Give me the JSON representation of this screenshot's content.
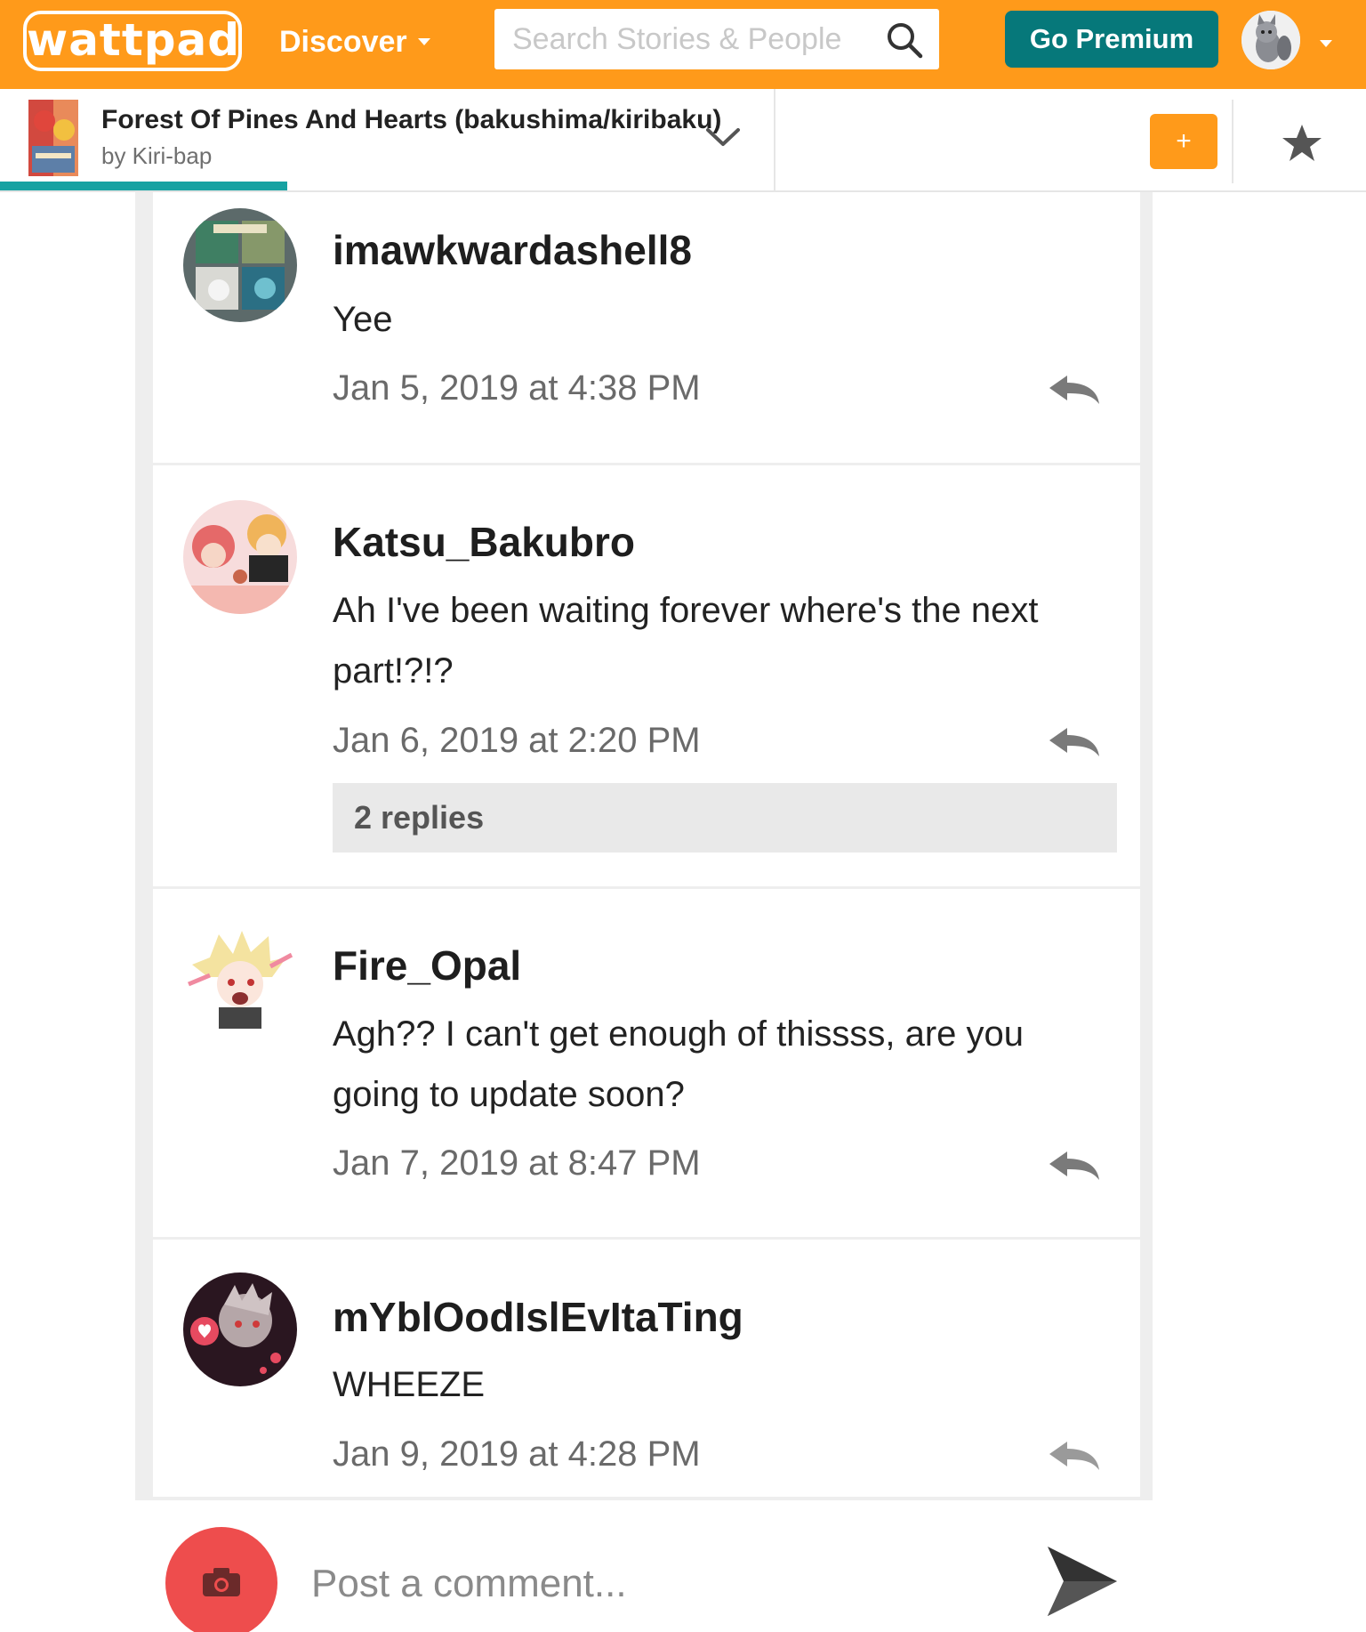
{
  "header": {
    "logo_text": "wattpad",
    "discover_label": "Discover",
    "search_placeholder": "Search Stories & People",
    "premium_label": "Go Premium",
    "brand_color": "#ff9a1a",
    "premium_color": "#06787a"
  },
  "story": {
    "title": "Forest Of Pines And Hearts (bakushima/kiribaku)",
    "author": "by Kiri-bap",
    "add_label": "+",
    "reading_progress": 0.21
  },
  "comments": [
    {
      "username": "imawkwardashell8",
      "text": "Yee",
      "timestamp": "Jan 5, 2019 at 4:38 PM"
    },
    {
      "username": "Katsu_Bakubro",
      "text": "Ah I've been waiting forever where's the next part!?!?",
      "timestamp": "Jan 6, 2019 at 2:20 PM",
      "replies_label": "2 replies"
    },
    {
      "username": "Fire_Opal",
      "text": "Agh?? I can't get enough of thissss, are you going to update soon?",
      "timestamp": "Jan 7, 2019 at 8:47 PM"
    },
    {
      "username": "mYblOodIslEvItaTing",
      "text": "WHEEZE",
      "timestamp": "Jan 9, 2019 at 4:28 PM"
    }
  ],
  "compose": {
    "placeholder": "Post a comment..."
  },
  "icons": {
    "search": "search-icon",
    "caret": "caret-down-icon",
    "chevron": "chevron-down-icon",
    "star": "star-icon",
    "reply": "reply-icon",
    "camera": "camera-icon",
    "send": "send-icon"
  }
}
